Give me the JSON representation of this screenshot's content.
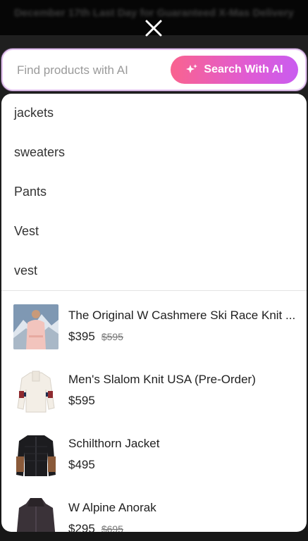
{
  "background": {
    "banner_text": "December 17th Last Day for Guaranteed X-Mas Delivery"
  },
  "close": {
    "icon": "close-icon"
  },
  "search": {
    "placeholder": "Find products with AI",
    "value": "",
    "button_label": "Search With AI",
    "button_icon": "sparkle-icon"
  },
  "suggestions": [
    {
      "label": "jackets"
    },
    {
      "label": "sweaters"
    },
    {
      "label": "Pants"
    },
    {
      "label": "Vest"
    },
    {
      "label": "vest"
    }
  ],
  "products": [
    {
      "name": "The Original W Cashmere Ski Race Knit ...",
      "price": "$395",
      "original_price": "$595",
      "thumbnail": "pink-sweater-model"
    },
    {
      "name": "Men's Slalom Knit USA (Pre-Order)",
      "price": "$595",
      "original_price": "",
      "thumbnail": "white-knit-sweater"
    },
    {
      "name": "Schilthorn Jacket",
      "price": "$495",
      "original_price": "",
      "thumbnail": "black-brown-jacket"
    },
    {
      "name": "W Alpine Anorak",
      "price": "$295",
      "original_price": "$695",
      "thumbnail": "dark-anorak"
    }
  ],
  "colors": {
    "accent_gradient_start": "#f9638f",
    "accent_gradient_end": "#c95cf0",
    "search_border": "#e6c7f2"
  }
}
